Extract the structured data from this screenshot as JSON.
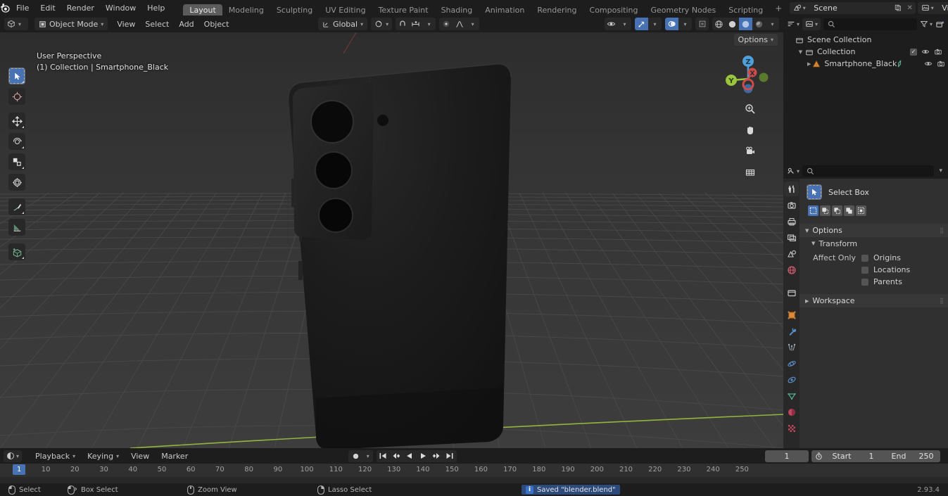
{
  "topbar": {
    "logo_icon": "blender-logo-icon",
    "menus": [
      "File",
      "Edit",
      "Render",
      "Window",
      "Help"
    ],
    "workspace_tabs": [
      {
        "label": "Layout",
        "active": true
      },
      {
        "label": "Modeling",
        "active": false
      },
      {
        "label": "Sculpting",
        "active": false
      },
      {
        "label": "UV Editing",
        "active": false
      },
      {
        "label": "Texture Paint",
        "active": false
      },
      {
        "label": "Shading",
        "active": false
      },
      {
        "label": "Animation",
        "active": false
      },
      {
        "label": "Rendering",
        "active": false
      },
      {
        "label": "Compositing",
        "active": false
      },
      {
        "label": "Geometry Nodes",
        "active": false
      },
      {
        "label": "Scripting",
        "active": false
      }
    ],
    "add_workspace": "+",
    "scene": {
      "icon": "scene-icon",
      "name": "Scene",
      "new_icon": "duplicate-icon",
      "unlink_icon": "x-icon"
    },
    "view_layer": {
      "icon": "view-layer-icon",
      "name": "View Layer",
      "new_icon": "duplicate-icon",
      "unlink_icon": "x-icon"
    }
  },
  "viewport": {
    "header": {
      "editor_type_icon": "editor-type-3dview-icon",
      "mode": "Object Mode",
      "menus": [
        "View",
        "Select",
        "Add",
        "Object"
      ],
      "transform_orientation": "Global",
      "snap_icon": "magnet-icon",
      "proportional_icon": "proportional-edit-icon",
      "options_label": "Options",
      "select_mode_icons": [
        "select-box-icon",
        "select-extend-icon",
        "select-subtract-icon",
        "select-invert-icon",
        "select-intersect-icon"
      ],
      "visibility_icon": "show-hide-icon",
      "gizmo_icon": "gizmo-icon",
      "overlays_icon": "overlays-icon",
      "xray_icon": "xray-icon",
      "shading_icons": [
        "wireframe-icon",
        "solid-icon",
        "material-preview-icon",
        "rendered-icon"
      ]
    },
    "overlay_line1": "User Perspective",
    "overlay_line2": "(1) Collection | Smartphone_Black",
    "tools": [
      {
        "name": "tweak-select-box-tool",
        "icon": "cursor-arrow-icon",
        "active": true
      },
      {
        "name": "cursor-tool",
        "icon": "3d-cursor-icon",
        "active": false
      },
      {
        "name": "move-tool",
        "icon": "move-arrows-icon",
        "active": false
      },
      {
        "name": "rotate-tool",
        "icon": "rotate-icon",
        "active": false
      },
      {
        "name": "scale-tool",
        "icon": "scale-icon",
        "active": false
      },
      {
        "name": "transform-tool",
        "icon": "transform-icon",
        "active": false
      },
      {
        "name": "annotate-tool",
        "icon": "pencil-icon",
        "active": false
      },
      {
        "name": "measure-tool",
        "icon": "ruler-icon",
        "active": false
      },
      {
        "name": "add-cube-tool",
        "icon": "add-cube-icon",
        "active": false
      }
    ],
    "gizmo": {
      "x": "X",
      "y": "Y",
      "z": "Z"
    },
    "nav_buttons": [
      "zoom-icon",
      "hand-pan-icon",
      "camera-icon",
      "ortho-persp-grid-icon"
    ],
    "object": {
      "name": "Smartphone_Black",
      "type": "smartphone-3d-model"
    }
  },
  "outliner": {
    "display_mode_icon": "filter-display-mode-icon",
    "view_layer_icon": "view-layer-icon",
    "search_placeholder": "",
    "search_icon": "search-icon",
    "filter_icon": "funnel-filter-icon",
    "new_collection_icon": "new-collection-icon",
    "rows": [
      {
        "label": "Scene Collection",
        "icon": "scene-collection-icon",
        "indent": 0,
        "expand": "",
        "checkbox": false,
        "eye": false,
        "camera": false
      },
      {
        "label": "Collection",
        "icon": "collection-icon",
        "indent": 1,
        "expand": "down",
        "checkbox": true,
        "eye": true,
        "camera": true
      },
      {
        "label": "Smartphone_Black",
        "icon": "mesh-object-icon",
        "indent": 2,
        "expand": "right",
        "checkbox": false,
        "eye": true,
        "camera": true,
        "modifier_icon": "mesh-data-icon"
      }
    ]
  },
  "properties": {
    "editor_type_icon": "properties-editor-icon",
    "search_placeholder": "",
    "search_icon": "search-icon",
    "expand_icon": "chevron-down-icon",
    "tabs": [
      {
        "name": "tool-tab",
        "icon": "tool-screwdriver-wrench-icon",
        "active": true
      },
      {
        "name": "render-tab",
        "icon": "render-camera-back-icon",
        "active": false
      },
      {
        "name": "output-tab",
        "icon": "output-printer-icon",
        "active": false
      },
      {
        "name": "view-layer-tab",
        "icon": "view-layer-images-icon",
        "active": false
      },
      {
        "name": "scene-tab",
        "icon": "scene-cone-sphere-icon",
        "active": false
      },
      {
        "name": "world-tab",
        "icon": "world-globe-icon",
        "active": false
      },
      {
        "name": "collection-tab",
        "icon": "collection-box-icon",
        "active": false
      },
      {
        "name": "object-tab",
        "icon": "object-orange-square-icon",
        "active": false
      },
      {
        "name": "modifier-tab",
        "icon": "wrench-icon",
        "active": false
      },
      {
        "name": "particles-tab",
        "icon": "particles-icon",
        "active": false
      },
      {
        "name": "physics-tab",
        "icon": "physics-orbit-icon",
        "active": false
      },
      {
        "name": "constraints-tab",
        "icon": "constraints-icon",
        "active": false
      },
      {
        "name": "data-tab",
        "icon": "mesh-data-triangle-icon",
        "active": false
      },
      {
        "name": "material-tab",
        "icon": "material-sphere-icon",
        "active": false
      },
      {
        "name": "texture-tab",
        "icon": "texture-checker-icon",
        "active": false
      }
    ],
    "active_tool": {
      "label": "Select Box",
      "icon": "select-box-tool-icon",
      "mode_icons": [
        "set-new-selection-icon",
        "extend-selection-icon",
        "subtract-selection-icon",
        "invert-selection-icon",
        "intersect-selection-icon"
      ]
    },
    "panels": [
      {
        "label": "Options",
        "expanded": true,
        "sub": {
          "label": "Transform",
          "expanded": true,
          "field_label": "Affect Only",
          "checkboxes": [
            {
              "label": "Origins",
              "checked": false
            },
            {
              "label": "Locations",
              "checked": false
            },
            {
              "label": "Parents",
              "checked": false
            }
          ]
        }
      },
      {
        "label": "Workspace",
        "expanded": false
      }
    ]
  },
  "timeline": {
    "editor_type_icon": "timeline-clock-icon",
    "menus": [
      "Playback",
      "Keying",
      "View",
      "Marker"
    ],
    "record_icon": "record-dot-icon",
    "transport_icons": [
      "jump-start-icon",
      "prev-keyframe-icon",
      "play-reverse-icon",
      "play-icon",
      "next-keyframe-icon",
      "jump-end-icon"
    ],
    "current_frame": "1",
    "autokey_icon": "stopwatch-icon",
    "start_label": "Start",
    "start_value": "1",
    "end_label": "End",
    "end_value": "250",
    "playhead_frame": "1",
    "ticks": [
      10,
      20,
      30,
      40,
      50,
      60,
      70,
      80,
      90,
      100,
      110,
      120,
      130,
      140,
      150,
      160,
      170,
      180,
      190,
      200,
      210,
      220,
      230,
      240,
      250
    ]
  },
  "statusbar": {
    "items": [
      {
        "icon": "mouse-left-icon",
        "label": "Select"
      },
      {
        "icon": "mouse-left-drag-icon",
        "label": "Box Select"
      },
      {
        "icon": "mouse-middle-icon",
        "label": "Zoom View"
      },
      {
        "icon": "mouse-right-icon",
        "label": "Lasso Select"
      }
    ],
    "message": "Saved \"blender.blend\"",
    "message_icon": "info-icon",
    "version": "2.93.4"
  },
  "colors": {
    "accent_blue": "#4772b3",
    "viewport_bg": "#393939",
    "panel_bg": "#303030",
    "header_bg": "#1d1d1d",
    "widget_bg": "#545454",
    "axis_green": "#9ac33e",
    "axis_red": "#cc4b4b",
    "axis_blue": "#4f9fd8",
    "tool_highlight": "#e9a23b",
    "saved_badge_bg": "#2d4a7c"
  }
}
